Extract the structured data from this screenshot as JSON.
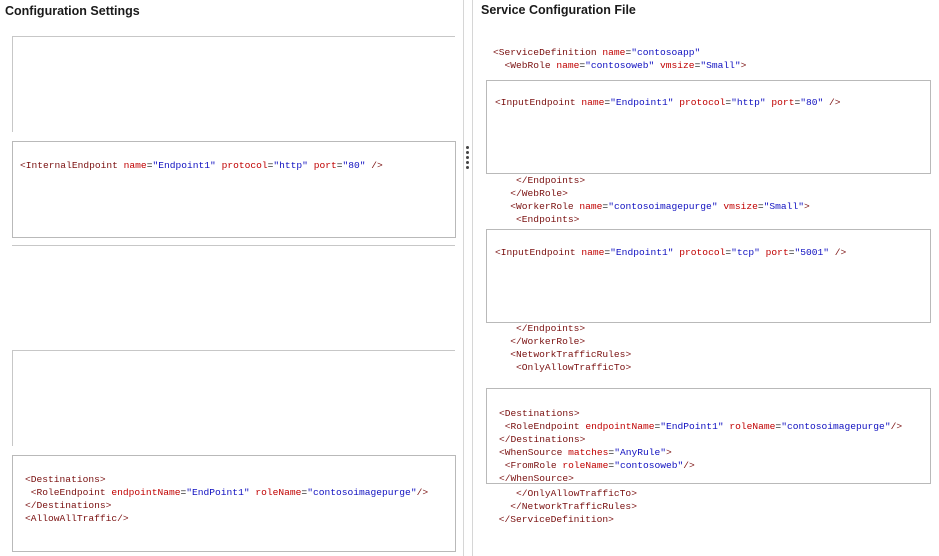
{
  "left_panel": {
    "title": "Configuration Settings",
    "options": [
      {
        "id": "internal-endpoint",
        "line": "<InternalEndpoint name=\"Endpoint1\" protocol=\"http\" port=\"80\" />"
      },
      {
        "id": "destinations-allow-all",
        "lines": [
          "<Destinations>",
          " <RoleEndpoint endpointName=\"EndPoint1\" roleName=\"contosoimagepurge\"/>",
          "</Destinations>",
          "<AllowAllTraffic/>"
        ]
      }
    ]
  },
  "right_panel": {
    "title": "Service Configuration File",
    "code": {
      "service_definition_open": "<ServiceDefinition name=\"contosoapp\"",
      "webrole_open": "  <WebRole name=\"contosoweb\" vmsize=\"Small\">",
      "slot1": "<InputEndpoint name=\"Endpoint1\" protocol=\"http\" port=\"80\" />",
      "endpoints_close_1": "    </Endpoints>",
      "webrole_close": "   </WebRole>",
      "workerrole_open": "   <WorkerRole name=\"contosoimagepurge\" vmsize=\"Small\">",
      "endpoints_open_2": "    <Endpoints>",
      "slot2": "<InputEndpoint name=\"Endpoint1\" protocol=\"tcp\" port=\"5001\" />",
      "endpoints_close_2": "    </Endpoints>",
      "workerrole_close": "   </WorkerRole>",
      "network_rules_open": "   <NetworkTrafficRules>",
      "only_allow_open": "    <OnlyAllowTrafficTo>",
      "slot3": [
        "<Destinations>",
        " <RoleEndpoint endpointName=\"EndPoint1\" roleName=\"contosoimagepurge\"/>",
        "</Destinations>",
        "<WhenSource matches=\"AnyRule\">",
        " <FromRole roleName=\"contosoweb\"/>",
        "</WhenSource>"
      ],
      "only_allow_close": "    </OnlyAllowTrafficTo>",
      "network_rules_close": "   </NetworkTrafficRules>",
      "service_definition_close": " </ServiceDefinition>"
    }
  }
}
